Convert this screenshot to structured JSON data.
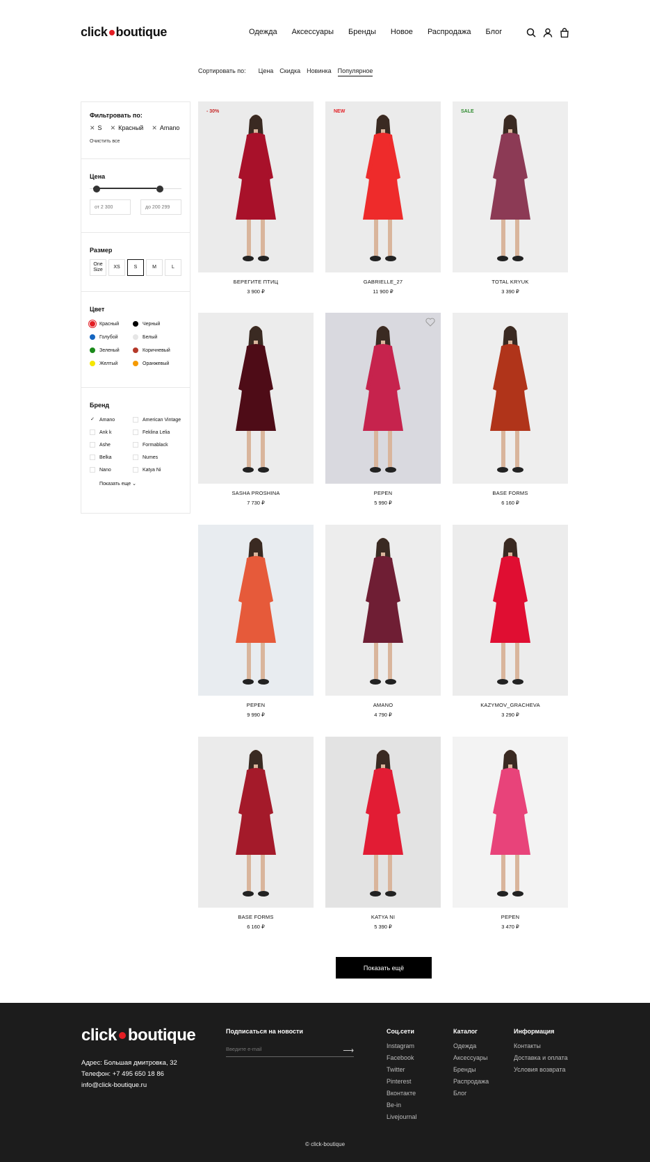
{
  "header": {
    "logo_left": "click",
    "logo_right": "boutique",
    "nav": [
      "Одежда",
      "Аксессуары",
      "Бренды",
      "Новое",
      "Распродажа",
      "Блог"
    ],
    "icons": [
      "search-icon",
      "user-icon",
      "bag-icon"
    ]
  },
  "sort": {
    "label": "Сортировать по:",
    "options": [
      "Цена",
      "Скидка",
      "Новинка",
      "Популярное"
    ],
    "active": "Популярное"
  },
  "filter": {
    "title": "Фильтровать по:",
    "chips": [
      "S",
      "Красный",
      "Amano"
    ],
    "clear": "Очистить все"
  },
  "price": {
    "title": "Цена",
    "from_placeholder": "от 2 300",
    "to_placeholder": "до 200 299"
  },
  "size": {
    "title": "Размер",
    "options": [
      "One Size",
      "XS",
      "S",
      "M",
      "L"
    ],
    "selected": "S"
  },
  "color": {
    "title": "Цвет",
    "options": [
      {
        "label": "Красный",
        "hex": "#e31e24",
        "selected": true
      },
      {
        "label": "Черный",
        "hex": "#000000"
      },
      {
        "label": "Голубой",
        "hex": "#1565c0"
      },
      {
        "label": "Белый",
        "hex": "#e6e6e6"
      },
      {
        "label": "Зеленый",
        "hex": "#1b8a1b"
      },
      {
        "label": "Коричневый",
        "hex": "#b5392a"
      },
      {
        "label": "Желтый",
        "hex": "#f5e600"
      },
      {
        "label": "Оранжевый",
        "hex": "#f59a00"
      }
    ]
  },
  "brand": {
    "title": "Бренд",
    "options": [
      {
        "label": "Amano",
        "checked": true
      },
      {
        "label": "American Vintage"
      },
      {
        "label": "Ank k"
      },
      {
        "label": "Feklina Lelia"
      },
      {
        "label": "Ashe"
      },
      {
        "label": "Formablack"
      },
      {
        "label": "Belka"
      },
      {
        "label": "Numes"
      },
      {
        "label": "Nano"
      },
      {
        "label": "Katya Ni"
      }
    ],
    "more": "Показать еще"
  },
  "products": [
    {
      "name": "БЕРЕГИТЕ ПТИЦ",
      "price": "3 900 ₽",
      "badge": "- 30%",
      "badge_color": "#c62828",
      "bg": "#ebebeb",
      "dress": "#a8112a"
    },
    {
      "name": "GABRIELLE_27",
      "price": "11 900 ₽",
      "badge": "NEW",
      "badge_color": "#e31e24",
      "bg": "#ebebeb",
      "dress": "#ee2b2b"
    },
    {
      "name": "TOTAL KRYUK",
      "price": "3 390 ₽",
      "badge": "SALE",
      "badge_color": "#2e8b2e",
      "bg": "#eeeeee",
      "dress": "#8c3a55"
    },
    {
      "name": "SASHA PROSHINA",
      "price": "7 730 ₽",
      "badge": "",
      "bg": "#ececec",
      "dress": "#4e0c17"
    },
    {
      "name": "PEPEN",
      "price": "5 990 ₽",
      "badge": "",
      "bg": "#d9d9df",
      "dress": "#c6234d",
      "heart": true
    },
    {
      "name": "BASE FORMS",
      "price": "6 160 ₽",
      "badge": "",
      "bg": "#eeeeee",
      "dress": "#b0341a"
    },
    {
      "name": "PEPEN",
      "price": "9 990 ₽",
      "badge": "",
      "bg": "#e8ecf0",
      "dress": "#e65a3a"
    },
    {
      "name": "AMANO",
      "price": "4 790 ₽",
      "badge": "",
      "bg": "#ededed",
      "dress": "#6f1e34"
    },
    {
      "name": "KAZYMOV_GRACHEVA",
      "price": "3 290 ₽",
      "badge": "",
      "bg": "#ececec",
      "dress": "#e00e32"
    },
    {
      "name": "BASE FORMS",
      "price": "6 160 ₽",
      "badge": "",
      "bg": "#ebebeb",
      "dress": "#a41a2a"
    },
    {
      "name": "KATYA NI",
      "price": "5 390 ₽",
      "badge": "",
      "bg": "#e3e3e3",
      "dress": "#e21c34"
    },
    {
      "name": "PEPEN",
      "price": "3 470 ₽",
      "badge": "",
      "bg": "#f3f3f3",
      "dress": "#e8437a"
    }
  ],
  "show_more": "Показать ещё",
  "footer": {
    "logo_left": "click",
    "logo_right": "boutique",
    "address": "Адрес: Большая дмитровка, 32",
    "phone": "Телефон: +7 495 650 18 86",
    "email": "info@click-boutique.ru",
    "subscribe_title": "Подписаться на новости",
    "email_placeholder": "Введите e-mail",
    "social_title": "Соц.сети",
    "social": [
      "Instagram",
      "Facebook",
      "Twitter",
      "Pinterest",
      "Вконтакте",
      "Be-in",
      "Livejournal"
    ],
    "catalog_title": "Каталог",
    "catalog": [
      "Одежда",
      "Аксессуары",
      "Бренды",
      "Распродажа",
      "Блог"
    ],
    "info_title": "Информация",
    "info": [
      "Контакты",
      "Доставка и оплата",
      "Условия возврата"
    ],
    "copyright": "© click-boutique"
  }
}
